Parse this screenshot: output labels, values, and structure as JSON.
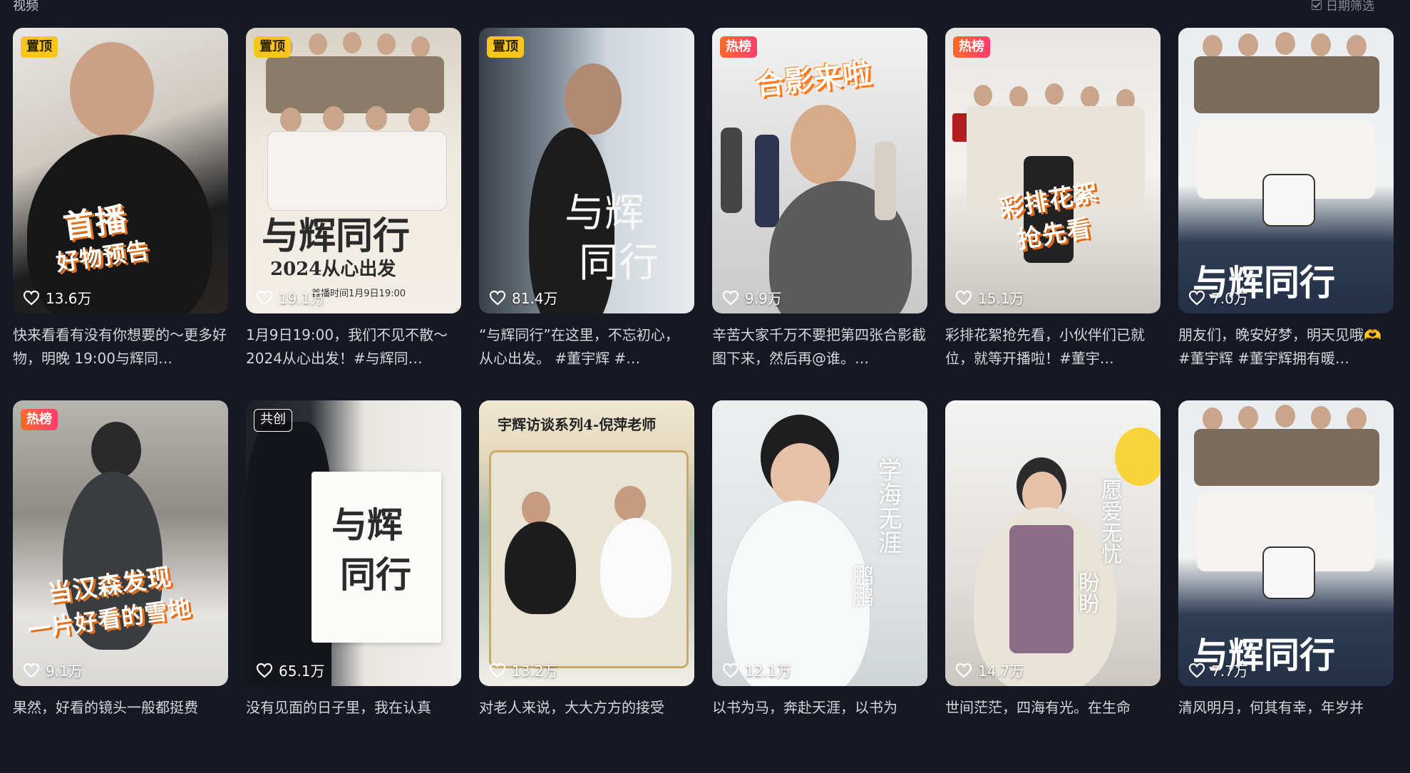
{
  "header": {
    "section_title": "视频",
    "date_filter_label": "日期筛选"
  },
  "videos": [
    {
      "badge": "置顶",
      "badge_type": "top",
      "overlay_lines": [
        "首播",
        "好物预告"
      ],
      "likes": "13.6万",
      "description": "快来看看有没有你想要的～更多好物，明晚 19:00与辉同…"
    },
    {
      "badge": "置顶",
      "badge_type": "top",
      "overlay_lines": [
        "与辉同行",
        "2024从心出发",
        "首播时间1月9日19:00"
      ],
      "likes": "19.1万",
      "description": "1月9日19:00，我们不见不散～2024从心出发！#与辉同…"
    },
    {
      "badge": "置顶",
      "badge_type": "top",
      "overlay_lines": [
        "与辉",
        "同行"
      ],
      "likes": "81.4万",
      "description": "“与辉同行”在这里，不忘初心，从心出发。 #董宇辉 #…"
    },
    {
      "badge": "热榜",
      "badge_type": "hot",
      "overlay_lines": [
        "合影来啦"
      ],
      "likes": "9.9万",
      "description": "辛苦大家千万不要把第四张合影截图下来，然后再@谁。…"
    },
    {
      "badge": "热榜",
      "badge_type": "hot",
      "overlay_lines": [
        "彩排花絮",
        "抢先看"
      ],
      "likes": "15.1万",
      "description": "彩排花絮抢先看，小伙伴们已就位，就等开播啦！#董宇…"
    },
    {
      "badge": "",
      "badge_type": "none",
      "overlay_lines": [
        "与辉同行"
      ],
      "likes": "7.0万",
      "description": "朋友们，晚安好梦，明天见哦🫶#董宇辉 #董宇辉拥有暖…"
    },
    {
      "badge": "热榜",
      "badge_type": "hot",
      "overlay_lines": [
        "当汉森发现",
        "一片好看的雪地"
      ],
      "likes": "9.1万",
      "description": "果然，好看的镜头一般都挺费"
    },
    {
      "badge": "共创",
      "badge_type": "co",
      "overlay_lines": [
        "与辉",
        "同行"
      ],
      "likes": "65.1万",
      "description": "没有见面的日子里，我在认真"
    },
    {
      "badge": "",
      "badge_type": "none",
      "overlay_lines": [
        "宇辉访谈系列4-倪萍老师"
      ],
      "likes": "13.2万",
      "description": "对老人来说，大大方方的接受"
    },
    {
      "badge": "",
      "badge_type": "none",
      "overlay_lines": [
        "学海无涯",
        "鹏鹏"
      ],
      "likes": "12.1万",
      "description": "以书为马，奔赴天涯，以书为"
    },
    {
      "badge": "",
      "badge_type": "none",
      "overlay_lines": [
        "愿爱无忧",
        "盼盼"
      ],
      "likes": "14.7万",
      "description": "世间茫茫，四海有光。在生命"
    },
    {
      "badge": "",
      "badge_type": "none",
      "overlay_lines": [
        "与辉同行"
      ],
      "likes": "7.7万",
      "description": "清风明月，何其有幸，年岁并"
    }
  ],
  "colors": {
    "background": "#161823",
    "badge_top": "#f7c51e",
    "badge_hot": "#ff4f4f"
  }
}
